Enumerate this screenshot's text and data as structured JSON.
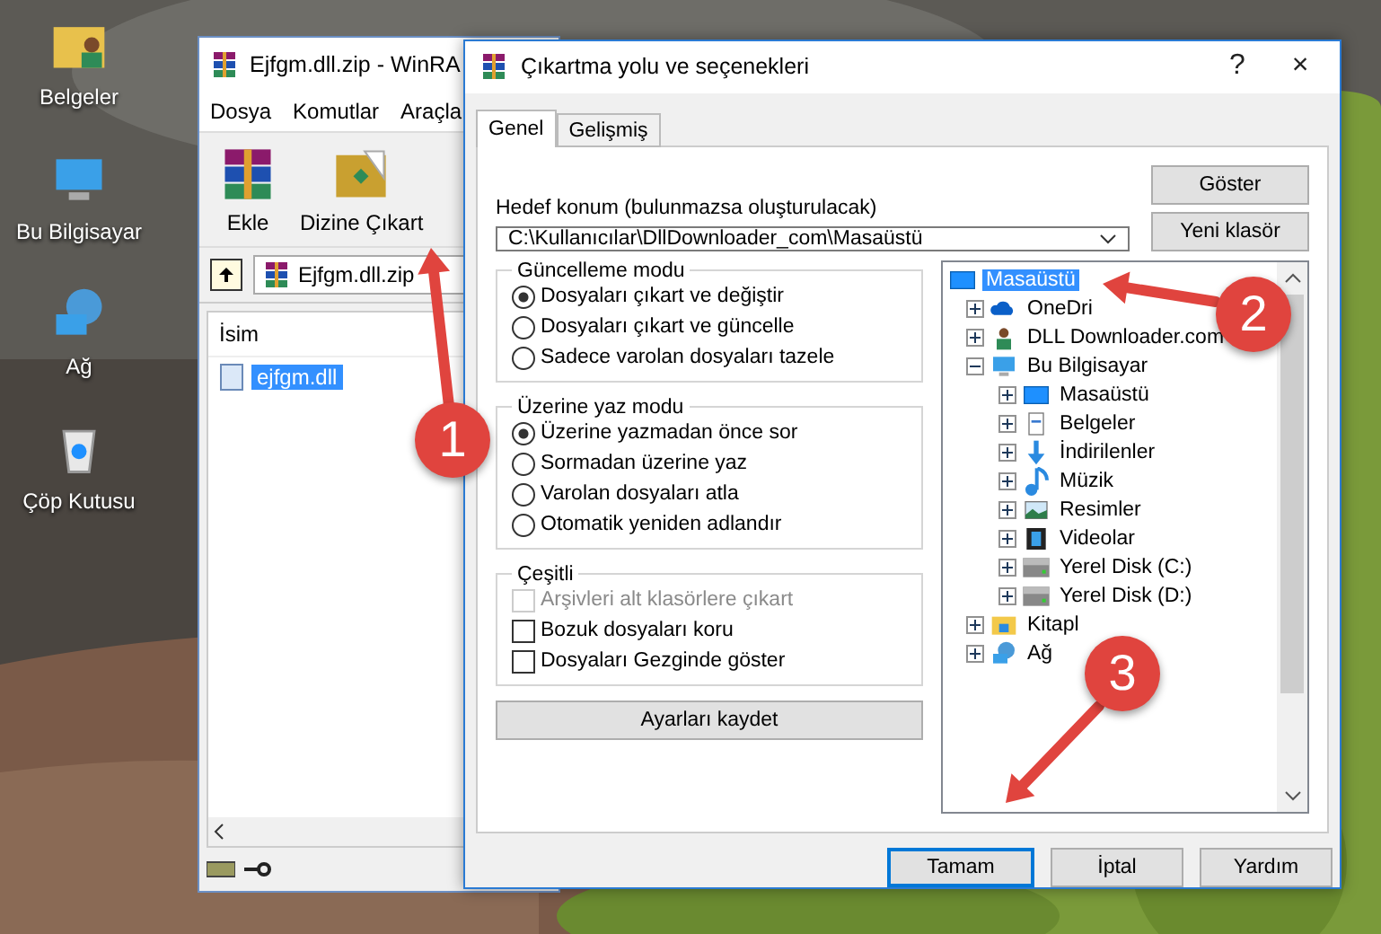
{
  "desktop_icons": [
    {
      "label": "Belgeler",
      "kind": "user-folder"
    },
    {
      "label": "Bu Bilgisayar",
      "kind": "computer"
    },
    {
      "label": "Ağ",
      "kind": "network"
    },
    {
      "label": "Çöp Kutusu",
      "kind": "recycle"
    }
  ],
  "winrar": {
    "title": "Ejfgm.dll.zip - WinRA",
    "menu": [
      "Dosya",
      "Komutlar",
      "Araçla"
    ],
    "toolbar": [
      {
        "label": "Ekle",
        "kind": "add"
      },
      {
        "label": "Dizine Çıkart",
        "kind": "extract"
      }
    ],
    "address": "Ejfgm.dll.zip",
    "column": "İsim",
    "files": [
      {
        "name": "ejfgm.dll",
        "selected": true
      }
    ]
  },
  "dialog": {
    "title": "Çıkartma yolu ve seçenekleri",
    "help": "?",
    "close": "×",
    "tabs": [
      {
        "label": "Genel",
        "selected": true
      },
      {
        "label": "Gelişmiş",
        "selected": false
      }
    ],
    "destination_label": "Hedef konum (bulunmazsa oluşturulacak)",
    "destination": "C:\\Kullanıcılar\\DllDownloader_com\\Masaüstü",
    "side_buttons": [
      "Göster",
      "Yeni klasör"
    ],
    "groups": [
      {
        "title": "Güncelleme modu",
        "kind": "radio",
        "options": [
          {
            "label": "Dosyaları çıkart ve değiştir",
            "selected": true
          },
          {
            "label": "Dosyaları çıkart ve güncelle",
            "selected": false
          },
          {
            "label": "Sadece varolan dosyaları tazele",
            "selected": false
          }
        ]
      },
      {
        "title": "Üzerine yaz modu",
        "kind": "radio",
        "options": [
          {
            "label": "Üzerine yazmadan önce sor",
            "selected": true
          },
          {
            "label": "Sormadan üzerine yaz",
            "selected": false
          },
          {
            "label": "Varolan dosyaları atla",
            "selected": false
          },
          {
            "label": "Otomatik yeniden adlandır",
            "selected": false
          }
        ]
      },
      {
        "title": "Çeşitli",
        "kind": "check",
        "options": [
          {
            "label": "Arşivleri alt klasörlere çıkart",
            "checked": false,
            "disabled": true
          },
          {
            "label": "Bozuk dosyaları koru",
            "checked": false,
            "disabled": false
          },
          {
            "label": "Dosyaları Gezginde göster",
            "checked": false,
            "disabled": false
          }
        ]
      }
    ],
    "save_button": "Ayarları kaydet",
    "tree": [
      {
        "label": "Masaüstü",
        "kind": "desktop",
        "selected": true,
        "children": [
          {
            "label": "OneDri",
            "kind": "cloud",
            "selected": false,
            "expanded": false
          },
          {
            "label": "DLL Downloader.com",
            "kind": "user",
            "selected": false,
            "expanded": false
          },
          {
            "label": "Bu Bilgisayar",
            "kind": "computer",
            "selected": false,
            "expanded": true,
            "children": [
              {
                "label": "Masaüstü",
                "kind": "desktop",
                "selected": false,
                "expanded": false
              },
              {
                "label": "Belgeler",
                "kind": "documents",
                "selected": false,
                "expanded": false
              },
              {
                "label": "İndirilenler",
                "kind": "download",
                "selected": false,
                "expanded": false
              },
              {
                "label": "Müzik",
                "kind": "music",
                "selected": false,
                "expanded": false
              },
              {
                "label": "Resimler",
                "kind": "pictures",
                "selected": false,
                "expanded": false
              },
              {
                "label": "Videolar",
                "kind": "video",
                "selected": false,
                "expanded": false
              },
              {
                "label": "Yerel Disk (C:)",
                "kind": "drive",
                "selected": false,
                "expanded": false
              },
              {
                "label": "Yerel Disk (D:)",
                "kind": "drive",
                "selected": false,
                "expanded": false
              }
            ]
          },
          {
            "label": "Kitapl",
            "kind": "library",
            "selected": false,
            "expanded": false
          },
          {
            "label": "Ağ",
            "kind": "network",
            "selected": false,
            "expanded": false
          }
        ]
      }
    ],
    "buttons": [
      {
        "label": "Tamam",
        "selected": true
      },
      {
        "label": "İptal",
        "selected": false
      },
      {
        "label": "Yardım",
        "selected": false
      }
    ]
  },
  "steps": [
    "1",
    "2",
    "3"
  ]
}
